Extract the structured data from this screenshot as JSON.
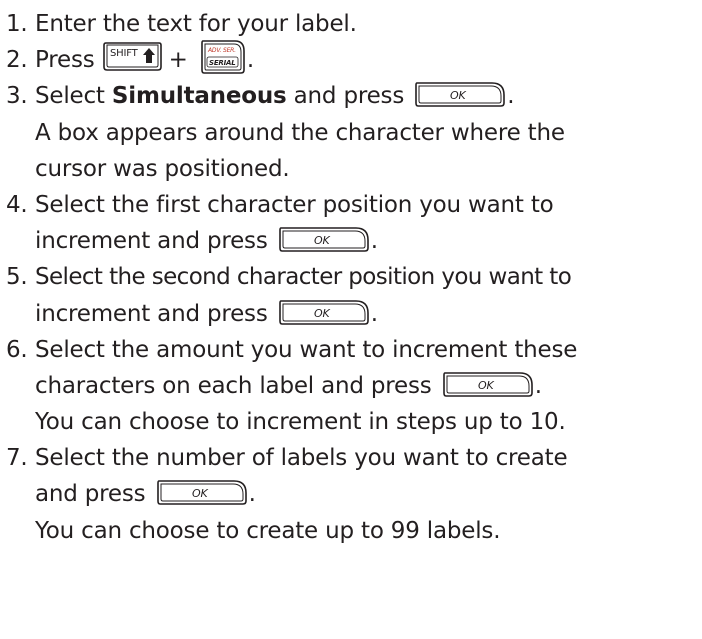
{
  "steps": [
    {
      "number": "1.",
      "lines": [
        "Enter the text for your label."
      ]
    },
    {
      "number": "2.",
      "press_text": "Press",
      "plus": "+",
      "tail": "."
    },
    {
      "number": "3.",
      "pre": "Select",
      "bold": "Simultaneous",
      "post": "and press",
      "tail": ".",
      "extra": [
        "A box appears around the character where the",
        "cursor was positioned."
      ]
    },
    {
      "number": "4.",
      "lines": [
        "Select the first character position you want to",
        "increment and press"
      ],
      "tail": "."
    },
    {
      "number": "5.",
      "lines": [
        "Select the second character position you want to",
        "increment and press"
      ],
      "tail": "."
    },
    {
      "number": "6.",
      "lines": [
        "Select the amount you want to increment these",
        "characters on each label and press"
      ],
      "tail": ".",
      "extra": [
        "You can choose to increment in steps up to 10."
      ]
    },
    {
      "number": "7.",
      "lines": [
        "Select the number of labels you want to create",
        "and press"
      ],
      "tail": ".",
      "extra": [
        "You can choose to create up to 99 labels."
      ]
    }
  ],
  "keys": {
    "ok": "OK",
    "shift": "SHIFT",
    "serial_top": "ADV. SER.",
    "serial_bottom": "SERIAL"
  },
  "icons": {
    "ok_key": "ok-key-icon",
    "shift_key": "shift-key-icon",
    "serial_key": "serial-key-icon"
  }
}
